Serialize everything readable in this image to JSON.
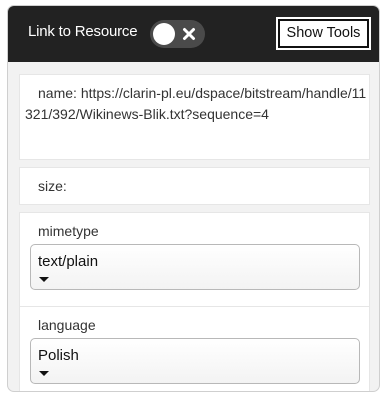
{
  "header": {
    "title": "Link to Resource",
    "toggle": {
      "state": "off",
      "off_icon": "close-icon"
    },
    "show_tools_label": "Show Tools"
  },
  "colors": {
    "header_background": "#222222",
    "panel_background": "#f2f2f2",
    "card_background": "#ffffff",
    "text": "#333333"
  },
  "resource": {
    "name": {
      "label": "name:",
      "value": "https://clarin-pl.eu/dspace/bitstream/handle/11321/392/Wikinews-Blik.txt?sequence=4"
    },
    "size": {
      "label": "size:",
      "value": ""
    },
    "mimetype": {
      "label": "mimetype",
      "selected": "text/plain"
    },
    "language": {
      "label": "language",
      "selected": "Polish"
    }
  }
}
